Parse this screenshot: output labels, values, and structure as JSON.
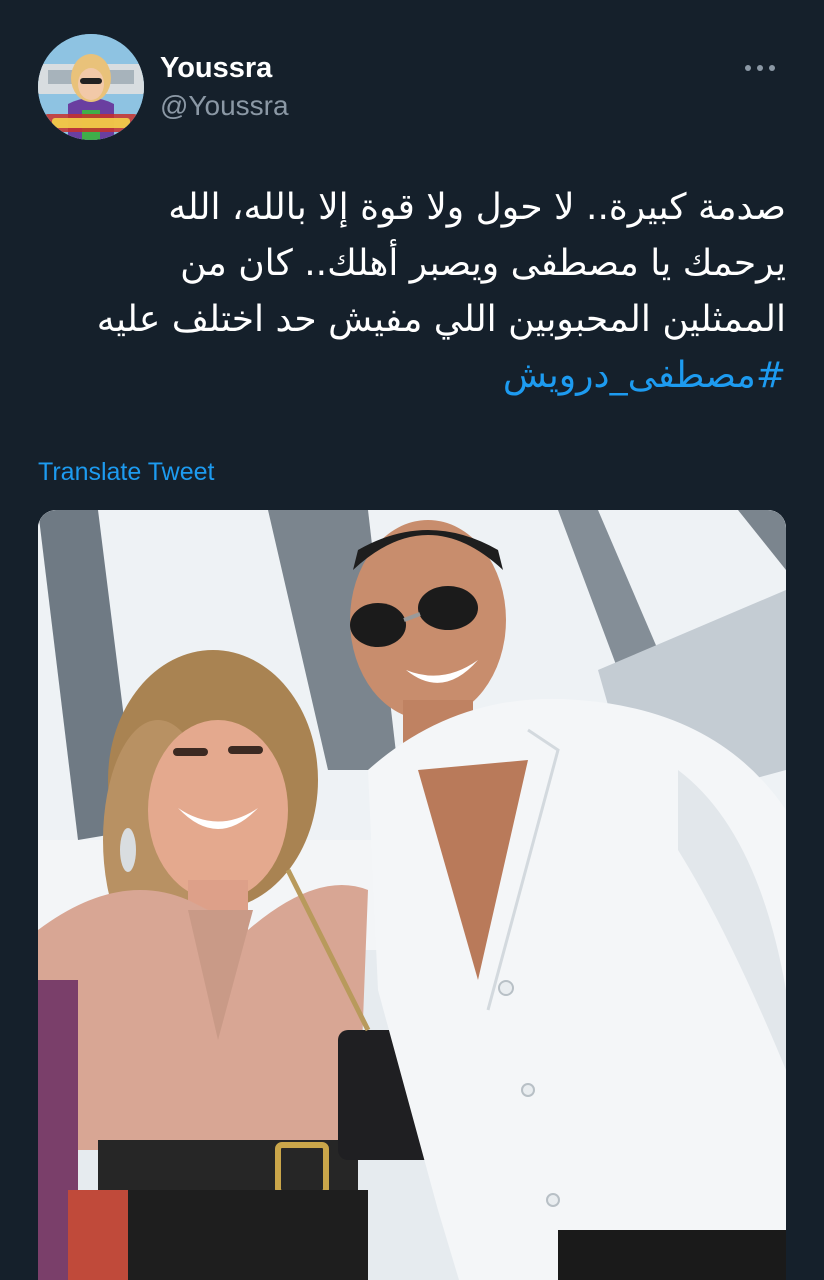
{
  "author": {
    "display_name": "Youssra",
    "handle": "@Youssra",
    "avatar_icon": "profile-photo"
  },
  "more_icon": "more-horizontal-icon",
  "tweet": {
    "lines": [
      "صدمة كبيرة.. لا حول ولا قوة إلا بالله، الله",
      "يرحمك يا مصطفى ويصبر أهلك.. كان من",
      "الممثلين المحبوبين اللي مفيش حد اختلف عليه"
    ],
    "hashtag": "#مصطفى_درويش"
  },
  "translate_label": "Translate Tweet",
  "colors": {
    "background": "#15202b",
    "text_primary": "#ffffff",
    "text_secondary": "#8b98a5",
    "accent": "#1d9bf0"
  }
}
